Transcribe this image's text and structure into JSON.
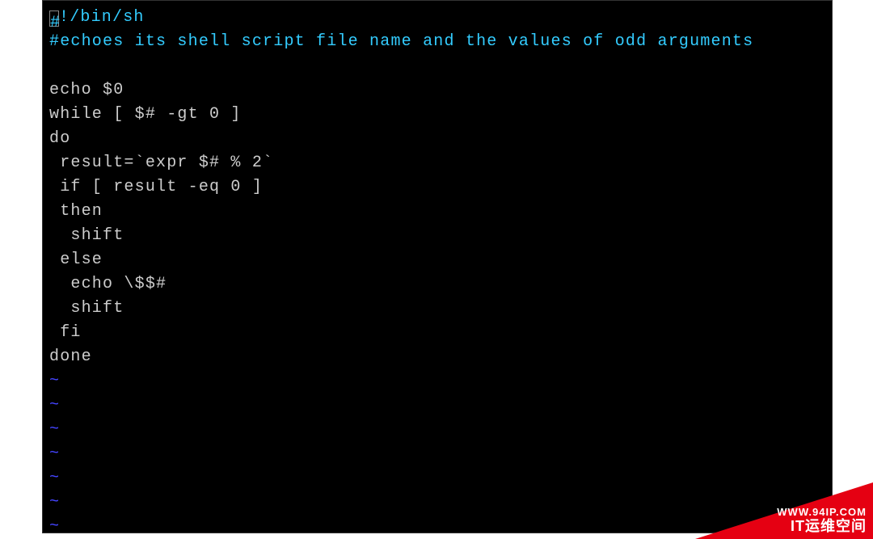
{
  "terminal": {
    "lines": [
      {
        "text": "#!/bin/sh",
        "class": "shebang",
        "hasCursor": true
      },
      {
        "text": "#echoes its shell script file name and the values of odd arguments",
        "class": "comment"
      },
      {
        "text": " ",
        "class": ""
      },
      {
        "text": "echo $0",
        "class": ""
      },
      {
        "text": "while [ $# -gt 0 ]",
        "class": ""
      },
      {
        "text": "do",
        "class": ""
      },
      {
        "text": " result=`expr $# % 2`",
        "class": ""
      },
      {
        "text": " if [ result -eq 0 ]",
        "class": ""
      },
      {
        "text": " then",
        "class": ""
      },
      {
        "text": "  shift",
        "class": ""
      },
      {
        "text": " else",
        "class": ""
      },
      {
        "text": "  echo \\$$#",
        "class": ""
      },
      {
        "text": "  shift",
        "class": ""
      },
      {
        "text": " fi",
        "class": ""
      },
      {
        "text": "done",
        "class": ""
      },
      {
        "text": "~",
        "class": "tilde"
      },
      {
        "text": "~",
        "class": "tilde"
      },
      {
        "text": "~",
        "class": "tilde"
      },
      {
        "text": "~",
        "class": "tilde"
      },
      {
        "text": "~",
        "class": "tilde"
      },
      {
        "text": "~",
        "class": "tilde"
      },
      {
        "text": "~",
        "class": "tilde"
      }
    ]
  },
  "watermark": {
    "url": "WWW.94IP.COM",
    "title": "IT运维空间"
  }
}
